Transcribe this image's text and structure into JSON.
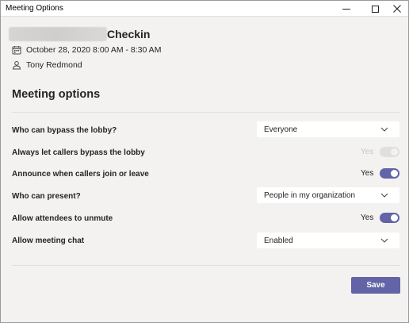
{
  "window": {
    "title": "Meeting Options"
  },
  "meeting": {
    "title": "Checkin",
    "datetime": "October 28, 2020 8:00 AM - 8:30 AM",
    "organizer": "Tony Redmond"
  },
  "section_title": "Meeting options",
  "options": {
    "bypass_lobby": {
      "label": "Who can bypass the lobby?",
      "value": "Everyone"
    },
    "callers_bypass": {
      "label": "Always let callers bypass the lobby",
      "state": "Yes",
      "enabled": false
    },
    "announce_callers": {
      "label": "Announce when callers join or leave",
      "state": "Yes",
      "enabled": true
    },
    "who_can_present": {
      "label": "Who can present?",
      "value": "People in my organization"
    },
    "attendees_unmute": {
      "label": "Allow attendees to unmute",
      "state": "Yes",
      "enabled": true
    },
    "meeting_chat": {
      "label": "Allow meeting chat",
      "value": "Enabled"
    }
  },
  "save_label": "Save",
  "colors": {
    "accent": "#6264a7",
    "background": "#f3f2f1",
    "disabled": "#c8c6c4"
  }
}
